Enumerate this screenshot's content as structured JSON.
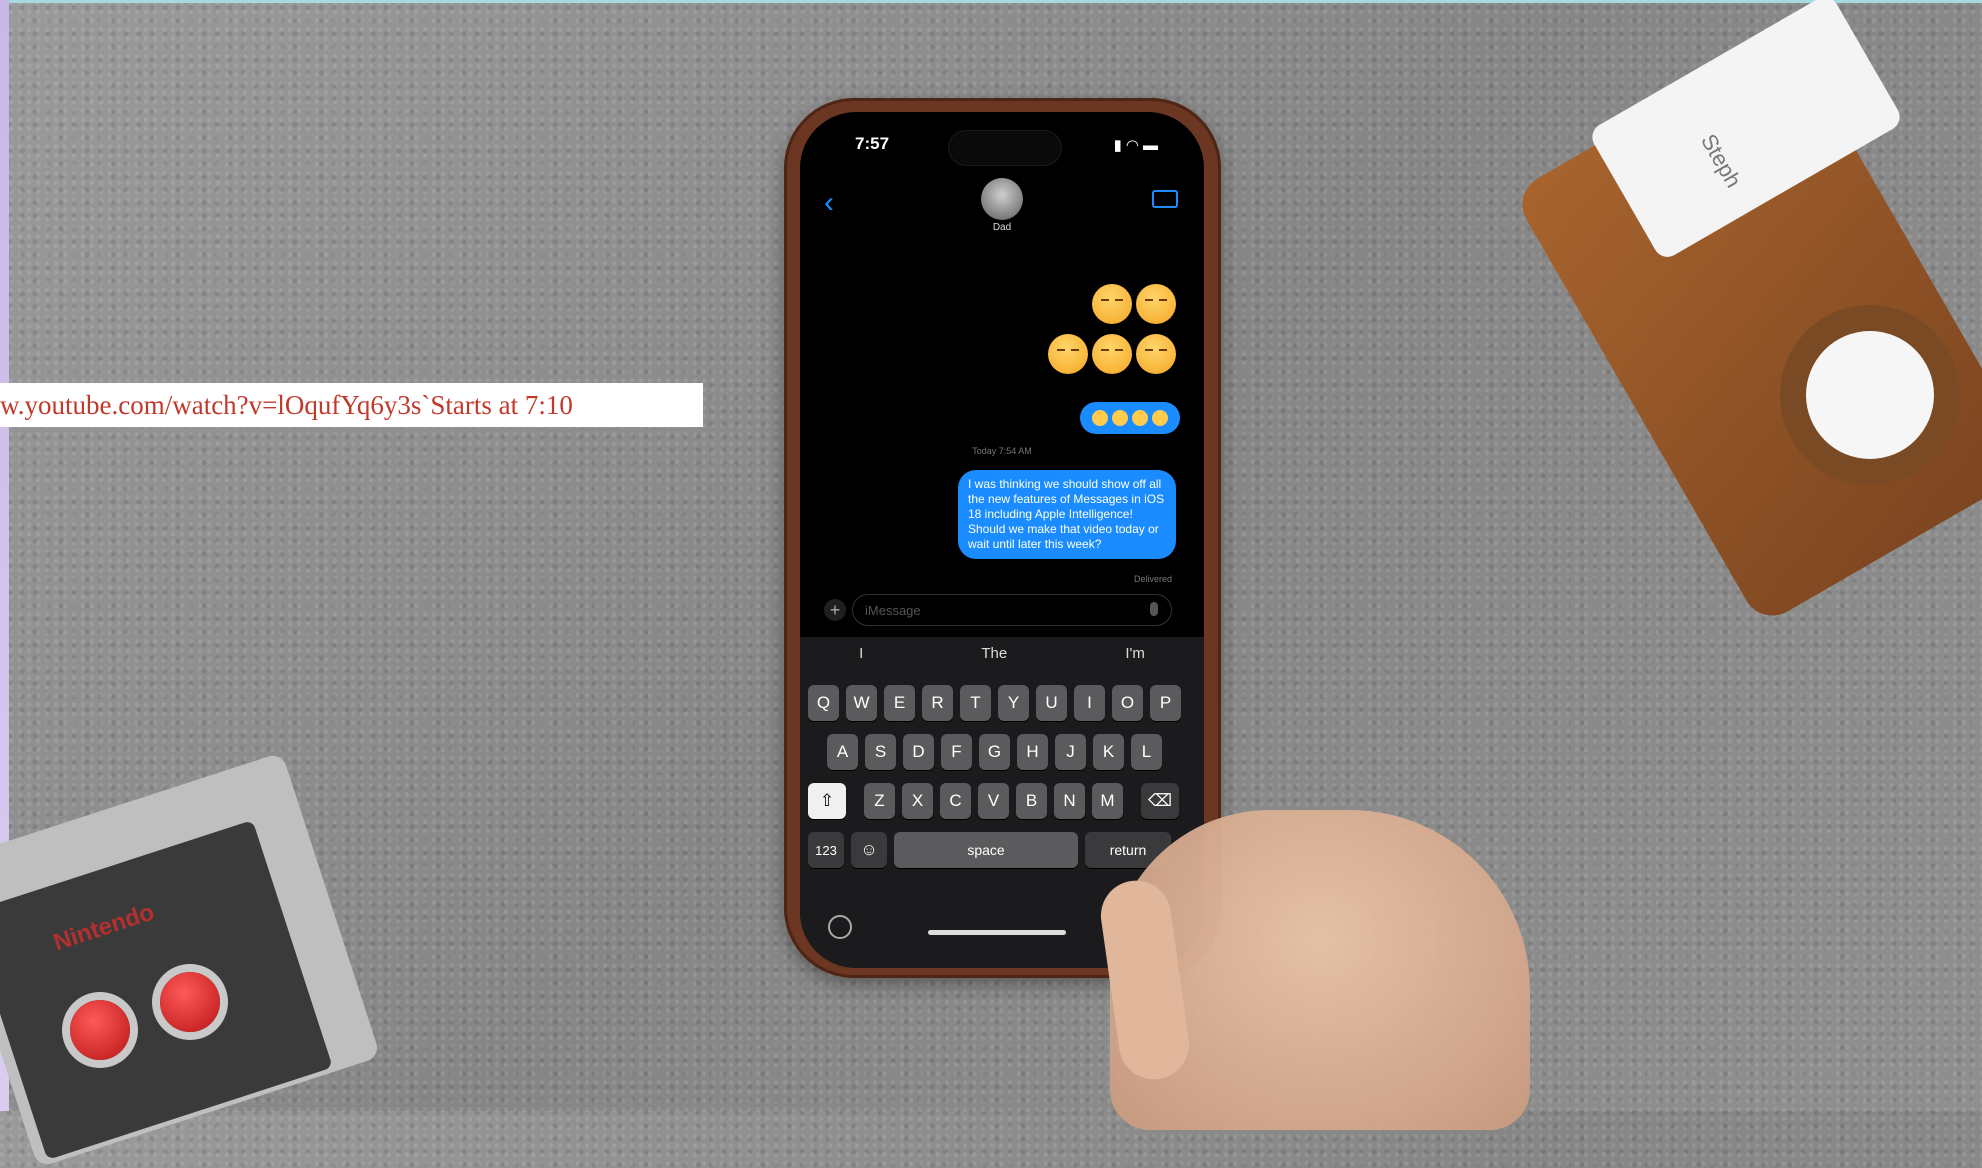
{
  "overlay": {
    "url_text": "w.youtube.com/watch?v=lOqufYq6y3s`Starts at 7:10"
  },
  "phone": {
    "status_time": "7:57",
    "contact_name": "Dad",
    "timestamp": "Today 7:54 AM",
    "message_text": "I was thinking we should show off all the new features of Messages in iOS 18 including Apple Intelligence! Should we make that video today or wait until later this week?",
    "delivered_label": "Delivered",
    "input_placeholder": "iMessage",
    "suggestions": [
      "I",
      "The",
      "I'm"
    ],
    "keyboard": {
      "row1": [
        "Q",
        "W",
        "E",
        "R",
        "T",
        "Y",
        "U",
        "I",
        "O",
        "P"
      ],
      "row2": [
        "A",
        "S",
        "D",
        "F",
        "G",
        "H",
        "J",
        "K",
        "L"
      ],
      "row3": [
        "Z",
        "X",
        "C",
        "V",
        "B",
        "N",
        "M"
      ],
      "num_label": "123",
      "space_label": "space",
      "return_label": "return"
    }
  },
  "props": {
    "card_text": "Steph",
    "controller_label": "Nintendo"
  },
  "icons": [
    "back-chevron-icon",
    "video-call-icon",
    "plus-icon",
    "mic-icon",
    "shift-icon",
    "delete-icon",
    "emoji-icon",
    "globe-icon",
    "wifi-icon",
    "battery-icon",
    "signal-icon"
  ],
  "colors": {
    "imessage_blue": "#1a8cff",
    "url_red": "#c0392b",
    "case_brown": "#6b3622"
  }
}
